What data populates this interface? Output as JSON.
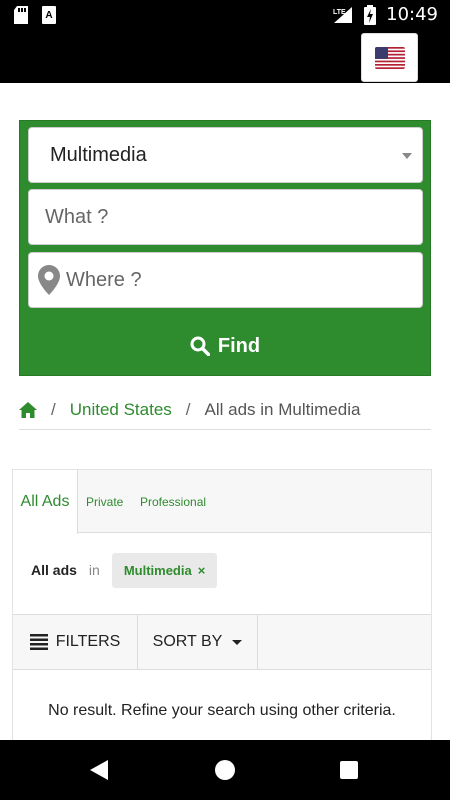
{
  "status_bar": {
    "time": "10:49",
    "network": "LTE",
    "icons": [
      "sd-card-icon",
      "keyboard-a-icon",
      "signal-icon",
      "battery-charging-icon"
    ]
  },
  "app_bar": {
    "language_flag": "us-flag-icon"
  },
  "search": {
    "category_value": "Multimedia",
    "what_placeholder": "What ?",
    "where_placeholder": "Where ?",
    "find_label": "Find"
  },
  "breadcrumb": {
    "home_icon": "home-icon",
    "country": "United States",
    "current": "All ads in Multimedia"
  },
  "results": {
    "tabs": [
      "All Ads",
      "Private",
      "Professional"
    ],
    "active_tab": "All Ads",
    "filter_label": "All ads",
    "filter_in": "in",
    "filter_chip": "Multimedia",
    "chip_remove": "×",
    "filters_label": "FILTERS",
    "sort_label": "SORT BY",
    "empty_message": "No result. Refine your search using other criteria."
  },
  "colors": {
    "accent": "#2e8b2e",
    "status_bar": "#000000"
  }
}
